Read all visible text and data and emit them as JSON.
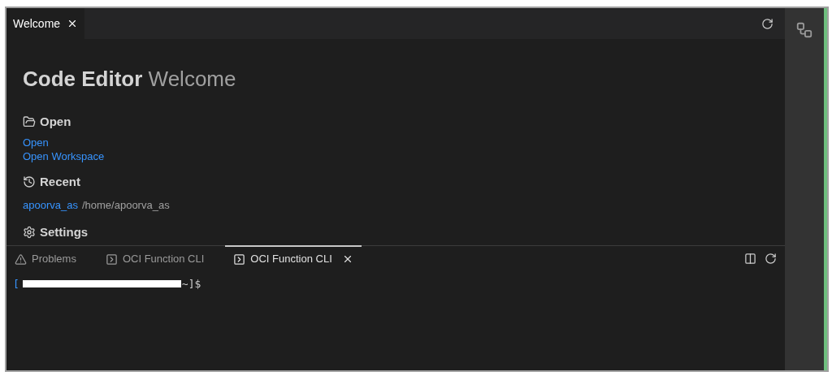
{
  "editor_tabs": [
    {
      "label": "Welcome",
      "selected": true,
      "closable": true
    }
  ],
  "welcome": {
    "title_bold": "Code Editor",
    "title_light": "Welcome",
    "sections": [
      {
        "kind": "open",
        "heading": "Open",
        "links": [
          {
            "label": "Open"
          },
          {
            "label": "Open Workspace"
          }
        ]
      },
      {
        "kind": "recent",
        "heading": "Recent",
        "entries": [
          {
            "name": "apoorva_as",
            "path": "/home/apoorva_as"
          }
        ]
      },
      {
        "kind": "settings",
        "heading": "Settings"
      }
    ]
  },
  "panel": {
    "tabs": [
      {
        "kind": "problems",
        "label": "Problems",
        "selected": false,
        "closable": false
      },
      {
        "kind": "terminal",
        "label": "OCI Function CLI",
        "selected": false,
        "closable": false
      },
      {
        "kind": "terminal",
        "label": "OCI Function CLI",
        "selected": true,
        "closable": true
      }
    ],
    "terminal": {
      "prompt_start": "[",
      "prompt_end": "~]$"
    }
  }
}
